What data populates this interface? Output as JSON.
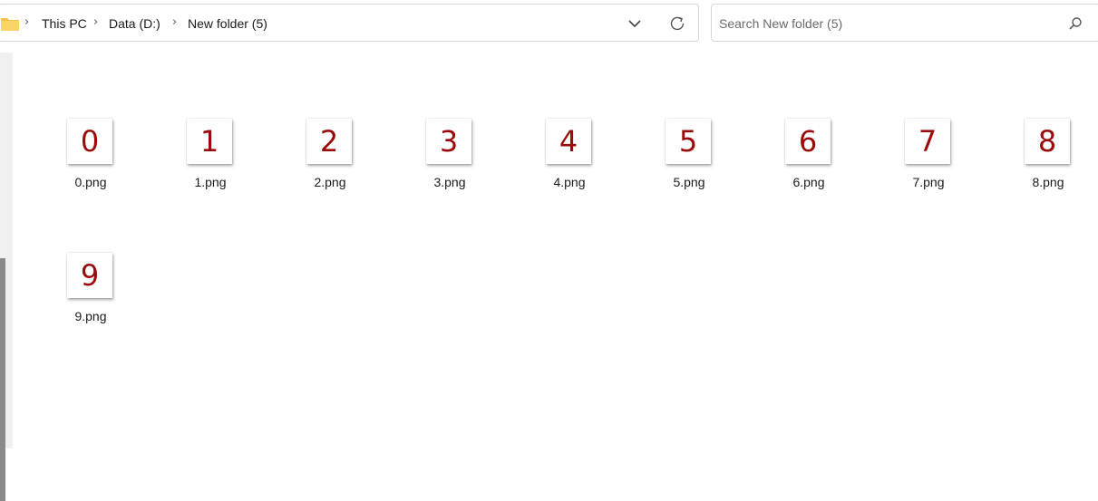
{
  "breadcrumb": {
    "items": [
      {
        "label": "This PC"
      },
      {
        "label": "Data (D:)"
      },
      {
        "label": "New folder (5)"
      }
    ],
    "separator": "›"
  },
  "search": {
    "placeholder": "Search New folder (5)",
    "value": ""
  },
  "icons": {
    "folder": "folder-icon",
    "dropdown": "chevron-down-icon",
    "refresh": "refresh-icon",
    "search": "search-icon"
  },
  "colors": {
    "thumbnail_digit": "#9b0a0a",
    "folder": "#f5c342"
  },
  "files": [
    {
      "name": "0.png",
      "thumb": "0"
    },
    {
      "name": "1.png",
      "thumb": "1"
    },
    {
      "name": "2.png",
      "thumb": "2"
    },
    {
      "name": "3.png",
      "thumb": "3"
    },
    {
      "name": "4.png",
      "thumb": "4"
    },
    {
      "name": "5.png",
      "thumb": "5"
    },
    {
      "name": "6.png",
      "thumb": "6"
    },
    {
      "name": "7.png",
      "thumb": "7"
    },
    {
      "name": "8.png",
      "thumb": "8"
    },
    {
      "name": "9.png",
      "thumb": "9"
    }
  ]
}
